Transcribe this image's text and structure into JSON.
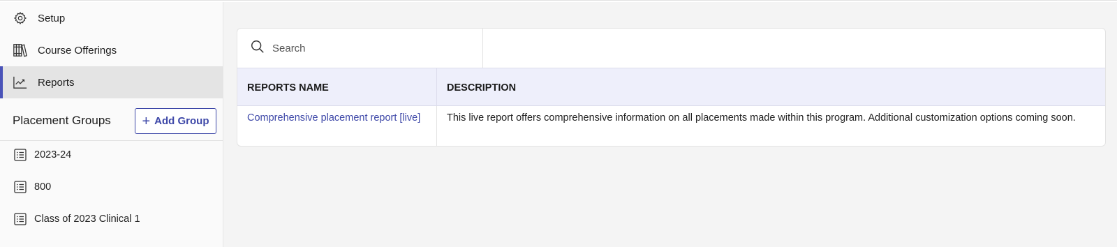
{
  "sidebar": {
    "nav": [
      {
        "label": "Setup",
        "icon": "gear-icon"
      },
      {
        "label": "Course Offerings",
        "icon": "books-icon"
      },
      {
        "label": "Reports",
        "icon": "chart-icon",
        "active": true
      }
    ],
    "placement_groups": {
      "title": "Placement Groups",
      "add_label": "Add Group",
      "items": [
        {
          "label": "2023-24",
          "icon": "list-icon"
        },
        {
          "label": "800",
          "icon": "list-icon"
        },
        {
          "label": "Class of 2023 Clinical 1",
          "icon": "list-icon"
        }
      ]
    }
  },
  "main": {
    "search": {
      "placeholder": "Search",
      "value": ""
    },
    "table": {
      "columns": [
        "REPORTS NAME",
        "DESCRIPTION"
      ],
      "rows": [
        {
          "name": "Comprehensive placement report [live]",
          "description": "This live report offers comprehensive information on all placements made within this program. Additional customization options coming soon."
        }
      ]
    }
  },
  "colors": {
    "accent": "#3e48a8",
    "active_bar": "#4a53b8",
    "header_bg": "#eeeffb"
  }
}
